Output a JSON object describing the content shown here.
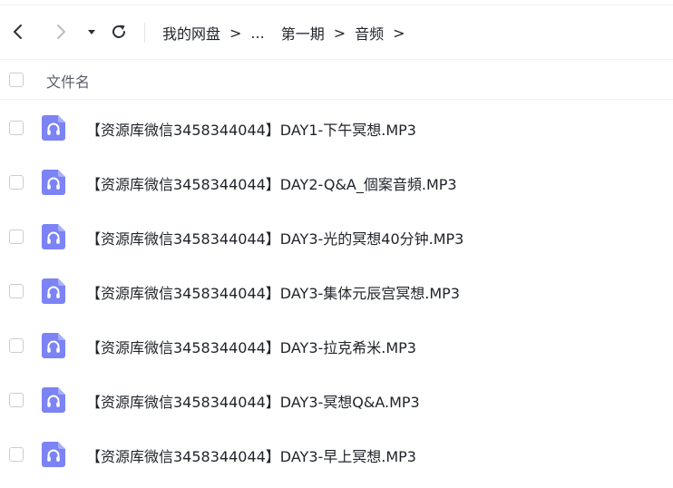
{
  "toolbar": {
    "back_icon": "chevron-left-icon",
    "forward_icon": "chevron-right-icon",
    "dropdown_icon": "caret-down-icon",
    "refresh_icon": "refresh-icon"
  },
  "breadcrumb": {
    "items": [
      "我的网盘",
      "...",
      "第一期",
      "音频"
    ],
    "separator": ">"
  },
  "list": {
    "header_label": "文件名",
    "file_icon": "audio-file-icon",
    "file_icon_color": "#7b83f5",
    "files": [
      "【资源库微信3458344044】DAY1-下午冥想.MP3",
      "【资源库微信3458344044】DAY2-Q&A_個案音頻.MP3",
      "【资源库微信3458344044】DAY3-光的冥想40分钟.MP3",
      "【资源库微信3458344044】DAY3-集体元辰宫冥想.MP3",
      "【资源库微信3458344044】DAY3-拉克希米.MP3",
      "【资源库微信3458344044】DAY3-冥想Q&A.MP3",
      "【资源库微信3458344044】DAY3-早上冥想.MP3"
    ]
  }
}
